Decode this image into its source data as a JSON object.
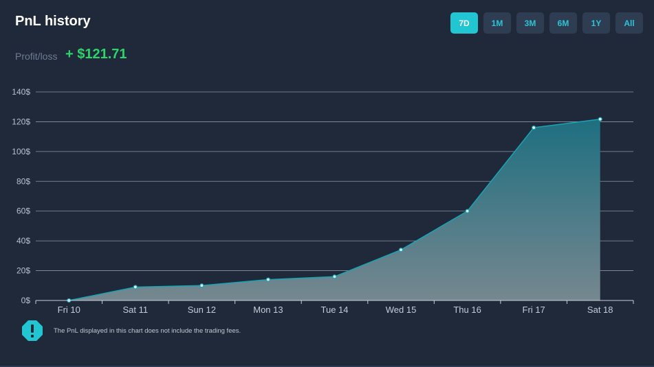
{
  "header": {
    "title": "PnL history",
    "ranges": [
      {
        "label": "7D",
        "active": true
      },
      {
        "label": "1M",
        "active": false
      },
      {
        "label": "3M",
        "active": false
      },
      {
        "label": "6M",
        "active": false
      },
      {
        "label": "1Y",
        "active": false
      },
      {
        "label": "All",
        "active": false
      }
    ]
  },
  "summary": {
    "label": "Profit/loss",
    "value": "+ $121.71"
  },
  "colors": {
    "accent": "#22c6d3",
    "profit": "#2bd56a",
    "background": "#1f293a"
  },
  "chart_data": {
    "type": "area",
    "categories": [
      "Fri 10",
      "Sat 11",
      "Sun 12",
      "Mon 13",
      "Tue 14",
      "Wed 15",
      "Thu 16",
      "Fri 17",
      "Sat 18"
    ],
    "values": [
      0,
      9,
      10,
      14,
      16,
      34,
      60,
      116,
      121.71
    ],
    "yticks": [
      "0$",
      "20$",
      "40$",
      "60$",
      "80$",
      "100$",
      "120$",
      "140$"
    ],
    "ylim": [
      0,
      140
    ],
    "grid": true,
    "title": "",
    "xlabel": "",
    "ylabel": ""
  },
  "note": {
    "icon": "exclamation-icon",
    "text": "The PnL displayed in this chart does not include the trading fees."
  }
}
